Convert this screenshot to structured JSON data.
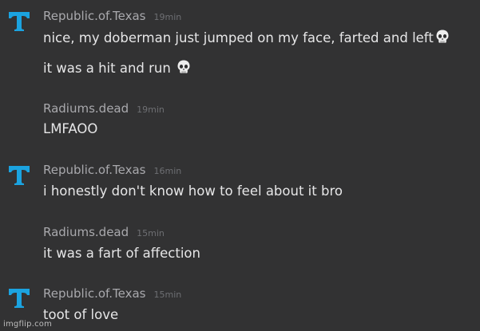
{
  "messages": [
    {
      "author": "Republic.of.Texas",
      "time": "19min",
      "avatar_icon": "texas-t-icon",
      "lines": [
        "nice, my doberman just jumped on my face, farted and left",
        "it was a hit and run "
      ],
      "emoji": [
        "skull-emoji",
        "skull-emoji"
      ]
    },
    {
      "author": "Radiums.dead",
      "time": "19min",
      "lines": [
        "LMFAOO"
      ]
    },
    {
      "author": "Republic.of.Texas",
      "time": "16min",
      "avatar_icon": "texas-t-icon",
      "lines": [
        "i honestly don't know how to feel about it bro"
      ]
    },
    {
      "author": "Radiums.dead",
      "time": "15min",
      "lines": [
        "it was a fart of affection"
      ]
    },
    {
      "author": "Republic.of.Texas",
      "time": "15min",
      "avatar_icon": "texas-t-icon",
      "lines": [
        "toot of love"
      ]
    }
  ],
  "watermark": "imgflip.com",
  "colors": {
    "background": "#323233",
    "avatar_blue": "#1ba3e0",
    "author": "#a9a9ad",
    "timestamp": "#6e6f73",
    "text": "#e6e6e7"
  }
}
